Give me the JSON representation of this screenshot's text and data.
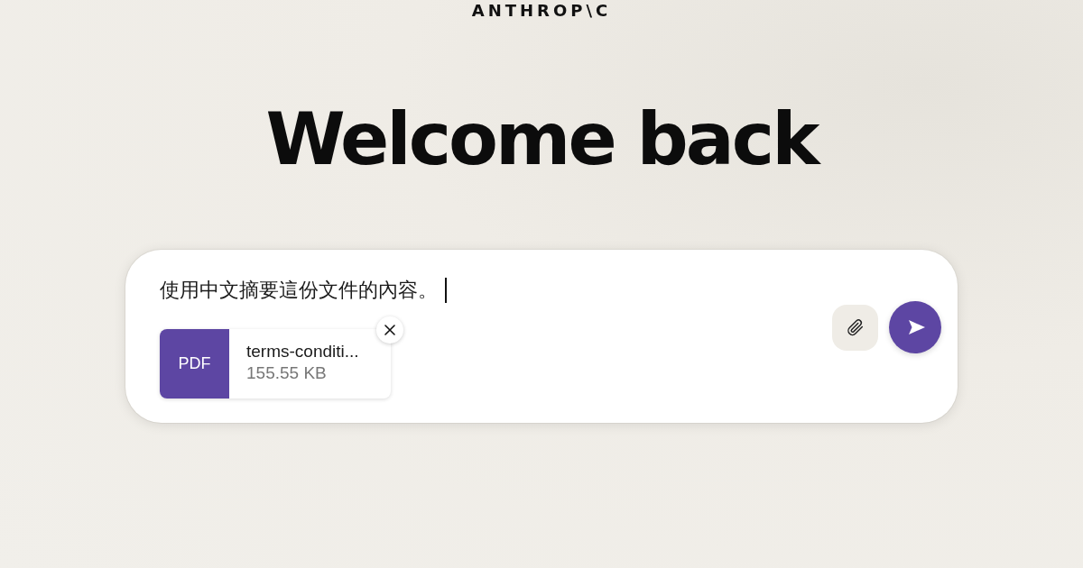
{
  "logo": "ANTHROP\\C",
  "heading": "Welcome back",
  "composer": {
    "value": "使用中文摘要這份文件的內容。",
    "attachment": {
      "type_label": "PDF",
      "name": "terms-conditi...",
      "size": "155.55 KB"
    }
  }
}
